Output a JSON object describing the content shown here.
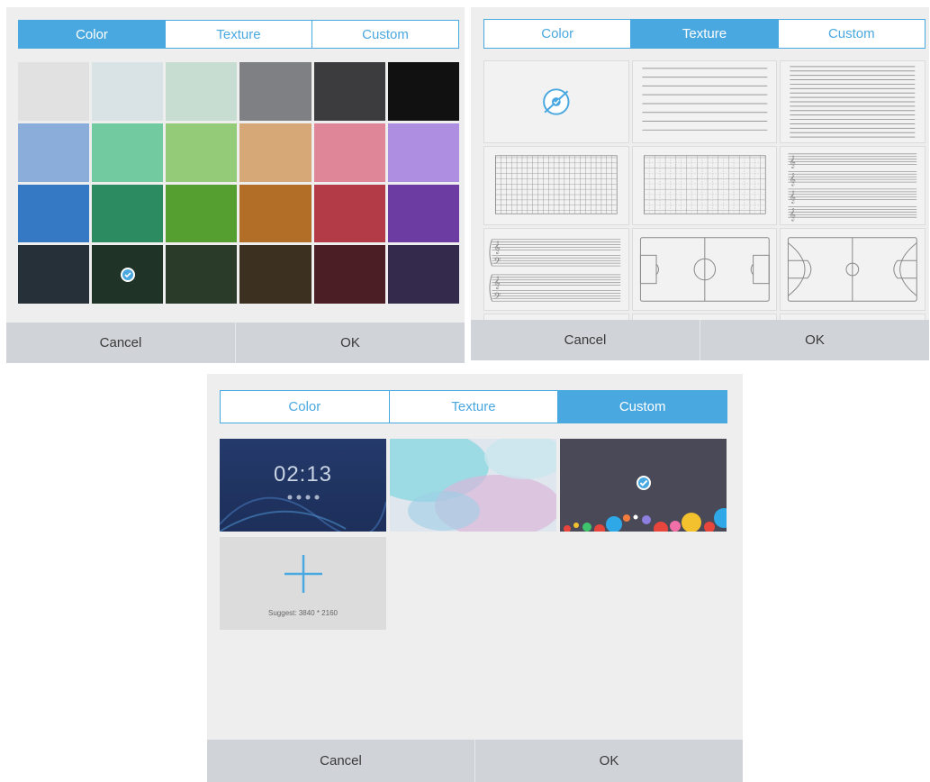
{
  "tabs": {
    "color": "Color",
    "texture": "Texture",
    "custom": "Custom"
  },
  "footer": {
    "cancel": "Cancel",
    "ok": "OK"
  },
  "color_panel": {
    "active_tab": "color",
    "selected_index": 19,
    "swatches": [
      "#e1e1e1",
      "#d9e2e5",
      "#c7ddd2",
      "#7f8083",
      "#3c3c3e",
      "#111111",
      "#8badda",
      "#72cba0",
      "#94cb79",
      "#d6a878",
      "#df8799",
      "#ad8ee0",
      "#3578c4",
      "#2d8b62",
      "#559f30",
      "#b26e27",
      "#b33b48",
      "#6c3ca2",
      "#263038",
      "#1f3327",
      "#2b3b29",
      "#3c3020",
      "#4a1e24",
      "#332a4c"
    ]
  },
  "texture_panel": {
    "active_tab": "texture",
    "selected_index": 0,
    "items": [
      "none-icon",
      "wide-lines-icon",
      "narrow-lines-icon",
      "grid-icon",
      "grid-dashed-icon",
      "music-staff-icon",
      "grand-staff-icon",
      "soccer-field-icon",
      "basketball-court-icon",
      "more-1",
      "more-2",
      "more-3"
    ]
  },
  "custom_panel": {
    "active_tab": "custom",
    "selected_index": 2,
    "thumb_clock": "02:13",
    "add_suggest": "Suggest: 3840 * 2160",
    "accent": "#4aa8e0"
  }
}
